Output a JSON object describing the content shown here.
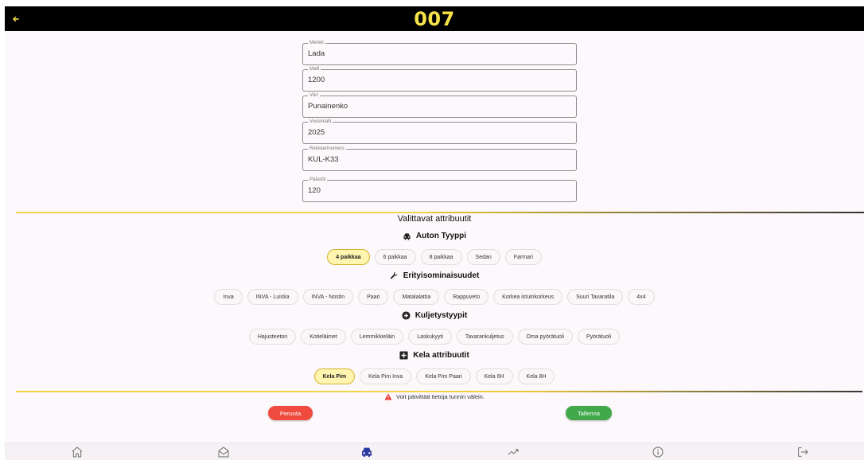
{
  "topbar": {
    "title": "007",
    "back_icon": "arrow-left-icon"
  },
  "fields": [
    {
      "label": "Merkki",
      "value": "Lada"
    },
    {
      "label": "Malli",
      "value": "1200"
    },
    {
      "label": "Väri",
      "value": "Punainenko"
    },
    {
      "label": "Vuosimalli",
      "value": "2025"
    },
    {
      "label": "Rekisterinumero",
      "value": "KUL-K33"
    },
    {
      "label": "Päästöt",
      "value": "120"
    }
  ],
  "attributes": {
    "title": "Valittavat attribuutit",
    "groups": [
      {
        "title": "Auton Tyyppi",
        "icon": "car-icon",
        "chips": [
          {
            "label": "4 paikkaa",
            "selected": true
          },
          {
            "label": "6 paikkaa",
            "selected": false
          },
          {
            "label": "8 paikkaa",
            "selected": false
          },
          {
            "label": "Sedan",
            "selected": false
          },
          {
            "label": "Farmari",
            "selected": false
          }
        ]
      },
      {
        "title": "Erityisominaisuudet",
        "icon": "wrench-icon",
        "chips": [
          {
            "label": "Inva",
            "selected": false
          },
          {
            "label": "INVA - Luiska",
            "selected": false
          },
          {
            "label": "INVA - Nostin",
            "selected": false
          },
          {
            "label": "Paari",
            "selected": false
          },
          {
            "label": "Matalalattia",
            "selected": false
          },
          {
            "label": "Rappuveto",
            "selected": false
          },
          {
            "label": "Korkea istuinkorkeus",
            "selected": false
          },
          {
            "label": "Suuri Tavaratila",
            "selected": false
          },
          {
            "label": "4x4",
            "selected": false
          }
        ]
      },
      {
        "title": "Kuljetystyypit",
        "icon": "plus-circle-icon",
        "chips": [
          {
            "label": "Hajusteeton",
            "selected": false
          },
          {
            "label": "Kotieläimet",
            "selected": false
          },
          {
            "label": "Lemmikkieläin",
            "selected": false
          },
          {
            "label": "Laskukyyti",
            "selected": false
          },
          {
            "label": "Tavarankuljetus",
            "selected": false
          },
          {
            "label": "Oma pyörätuoli",
            "selected": false
          },
          {
            "label": "Pyörätuoli",
            "selected": false
          }
        ]
      },
      {
        "title": "Kela attribuutit",
        "icon": "medical-cross-icon",
        "chips": [
          {
            "label": "Kela Pim",
            "selected": true
          },
          {
            "label": "Kela Pim Inva",
            "selected": false
          },
          {
            "label": "Kela Pim Paari",
            "selected": false
          },
          {
            "label": "Kela 6H",
            "selected": false
          },
          {
            "label": "Kela 8H",
            "selected": false
          }
        ]
      }
    ]
  },
  "warning": {
    "text": "Voit päivittää tietoja tunnin välein.",
    "icon": "warning-triangle-icon",
    "color": "#e53935"
  },
  "actions": {
    "cancel_label": "Peruuta",
    "save_label": "Tallenna",
    "cancel_color": "#ef4b3f",
    "save_color": "#41a84c"
  },
  "bottom_nav": [
    {
      "icon": "home-icon",
      "active": false
    },
    {
      "icon": "mail-open-icon",
      "active": false
    },
    {
      "icon": "car-icon",
      "active": true
    },
    {
      "icon": "trending-up-icon",
      "active": false
    },
    {
      "icon": "info-icon",
      "active": false
    },
    {
      "icon": "logout-icon",
      "active": false
    }
  ],
  "colors": {
    "accent": "#f6e34a",
    "active_nav": "#2c3b9e"
  }
}
